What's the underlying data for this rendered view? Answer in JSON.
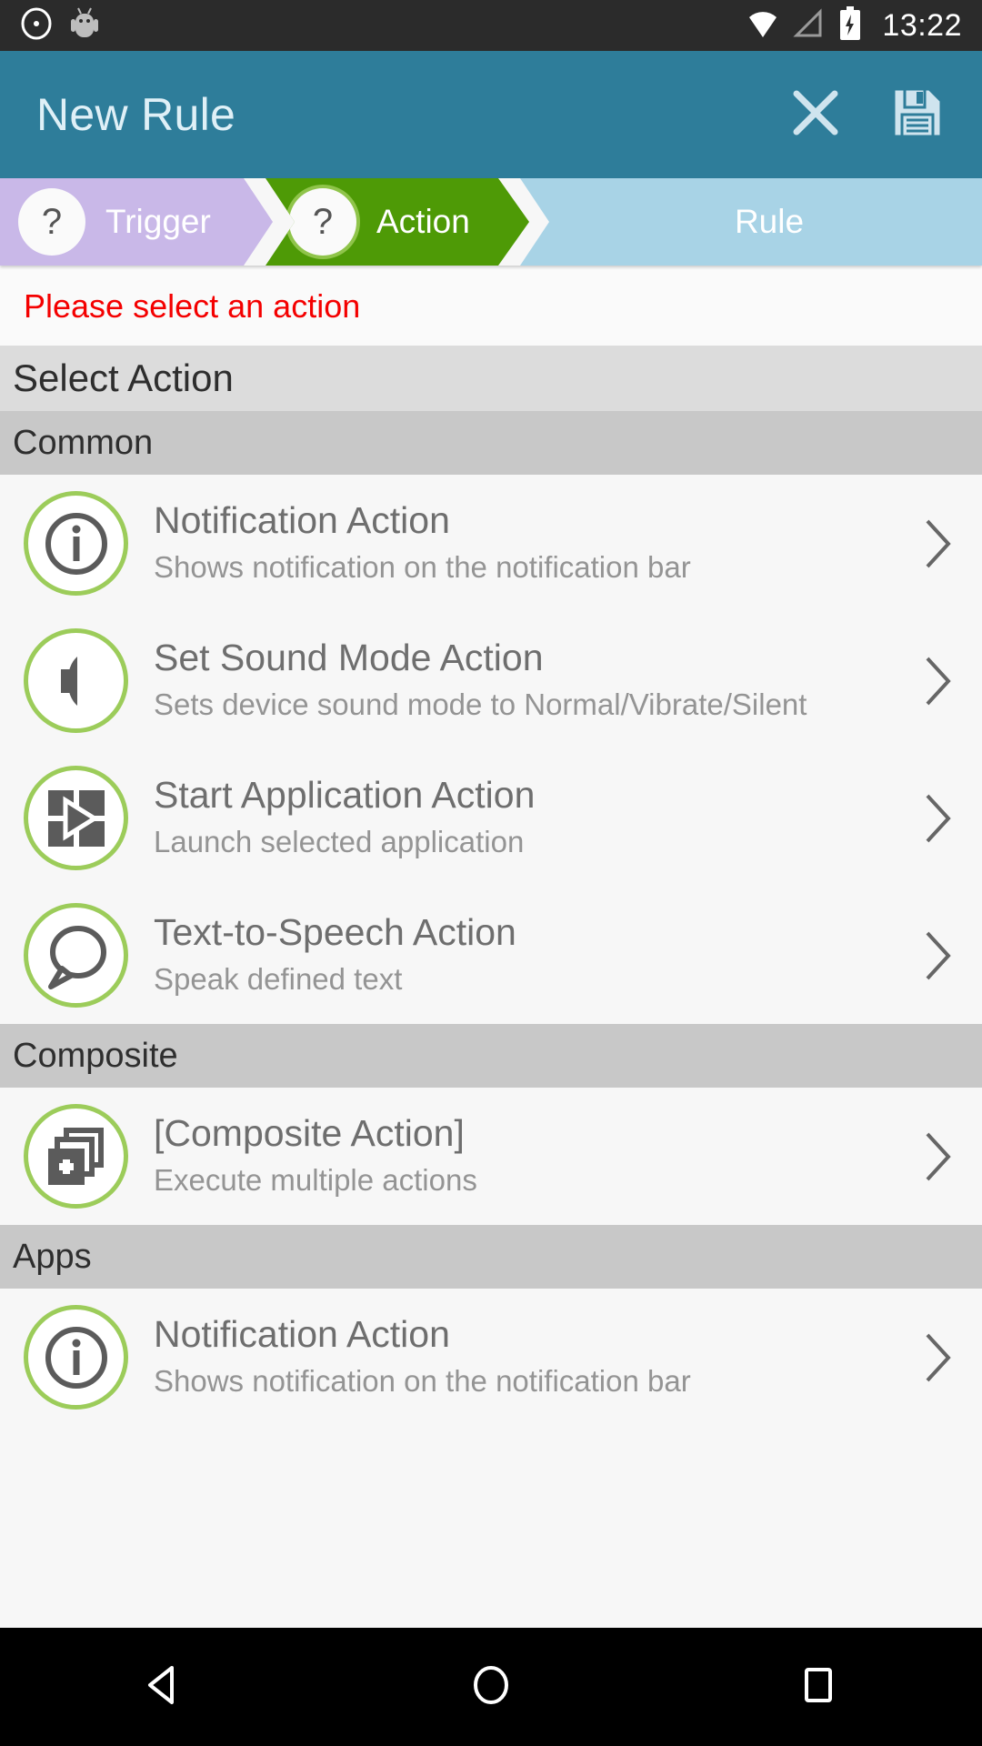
{
  "status_bar": {
    "time": "13:22",
    "icons": [
      "cyanogenmod-icon",
      "android-robot-icon",
      "wifi-icon",
      "signal-icon",
      "battery-charging-icon"
    ]
  },
  "app_bar": {
    "title": "New Rule",
    "close_label": "close-icon",
    "save_label": "save-icon"
  },
  "breadcrumb": {
    "steps": [
      {
        "label": "Trigger",
        "badge": "?",
        "state": "pending"
      },
      {
        "label": "Action",
        "badge": "?",
        "state": "active"
      },
      {
        "label": "Rule",
        "badge": "",
        "state": "upcoming"
      }
    ]
  },
  "error": {
    "text": "Please select an action",
    "color": "#f40000"
  },
  "section": {
    "title": "Select Action"
  },
  "groups": [
    {
      "header": "Common",
      "items": [
        {
          "icon": "info-icon",
          "title": "Notification Action",
          "subtitle": "Shows notification on the notification bar"
        },
        {
          "icon": "speaker-icon",
          "title": "Set Sound Mode Action",
          "subtitle": "Sets device sound mode to Normal/Vibrate/Silent"
        },
        {
          "icon": "start-application-icon",
          "title": "Start Application Action",
          "subtitle": "Launch selected application"
        },
        {
          "icon": "speech-bubble-icon",
          "title": "Text-to-Speech Action",
          "subtitle": "Speak defined text"
        }
      ]
    },
    {
      "header": "Composite",
      "items": [
        {
          "icon": "stacked-plus-icon",
          "title": "[Composite Action]",
          "subtitle": "Execute multiple actions"
        }
      ]
    },
    {
      "header": "Apps",
      "items": [
        {
          "icon": "info-icon",
          "title": "Notification Action",
          "subtitle": "Shows notification on the notification bar"
        }
      ]
    }
  ],
  "nav_bar": {
    "back": "back-icon",
    "home": "home-icon",
    "recents": "recents-icon"
  },
  "colors": {
    "app_bar": "#2e7d9a",
    "active_step": "#4e9a06",
    "trigger_step": "#c9b8e8",
    "rule_step": "#a8d3e6",
    "icon_ring": "#9ccc5a",
    "error": "#f40000"
  }
}
